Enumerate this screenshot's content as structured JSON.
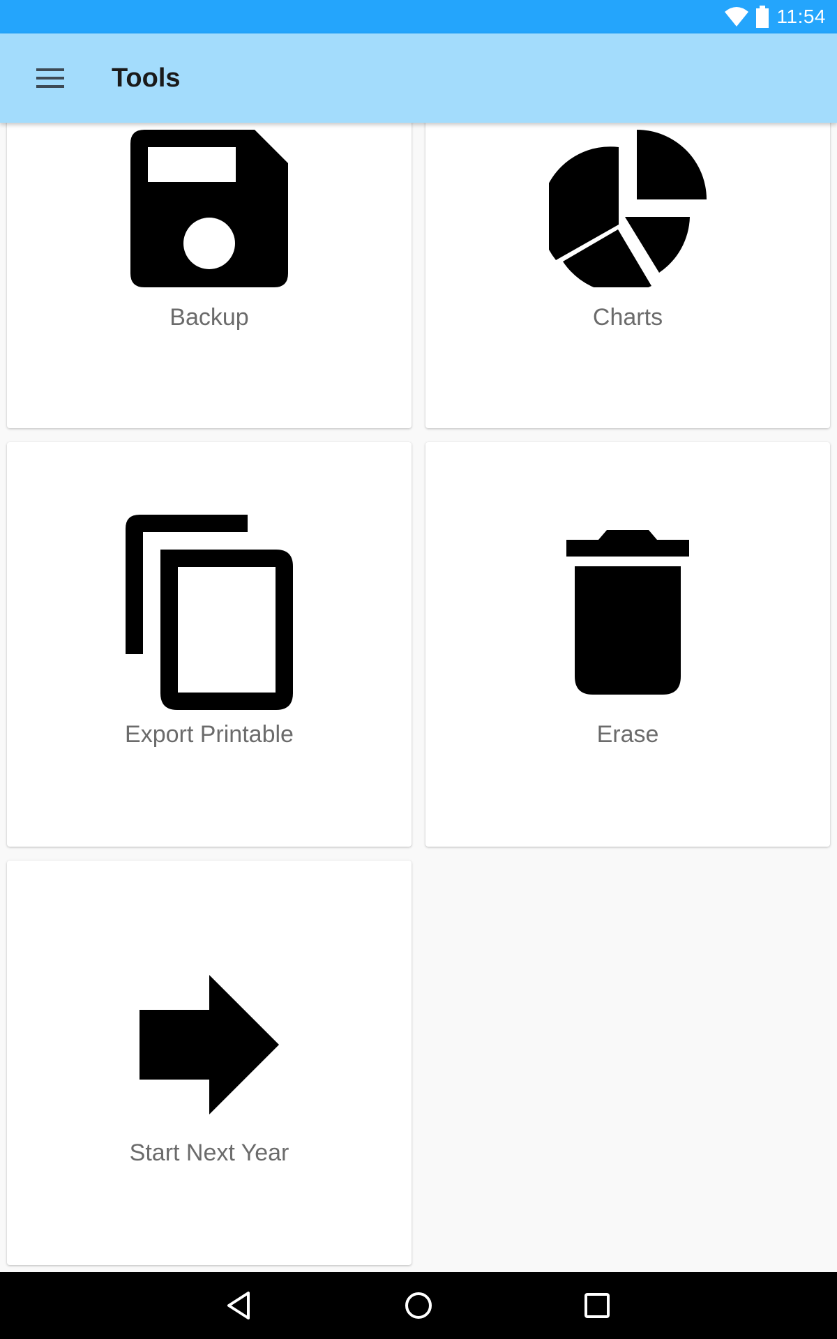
{
  "status_bar": {
    "time": "11:54",
    "icons": [
      "wifi-icon",
      "battery-icon"
    ],
    "color": "#24a5fc"
  },
  "app_bar": {
    "title": "Tools",
    "menu_icon": "menu-icon",
    "color": "#a3dcfc"
  },
  "tools": [
    {
      "label": "Backup",
      "icon": "floppy-disk-icon"
    },
    {
      "label": "Charts",
      "icon": "pie-chart-icon"
    },
    {
      "label": "Export Printable",
      "icon": "copy-icon"
    },
    {
      "label": "Erase",
      "icon": "trash-icon"
    },
    {
      "label": "Start Next Year",
      "icon": "arrow-right-icon"
    }
  ],
  "nav_bar": {
    "buttons": [
      "back-icon",
      "home-icon",
      "recents-icon"
    ]
  }
}
